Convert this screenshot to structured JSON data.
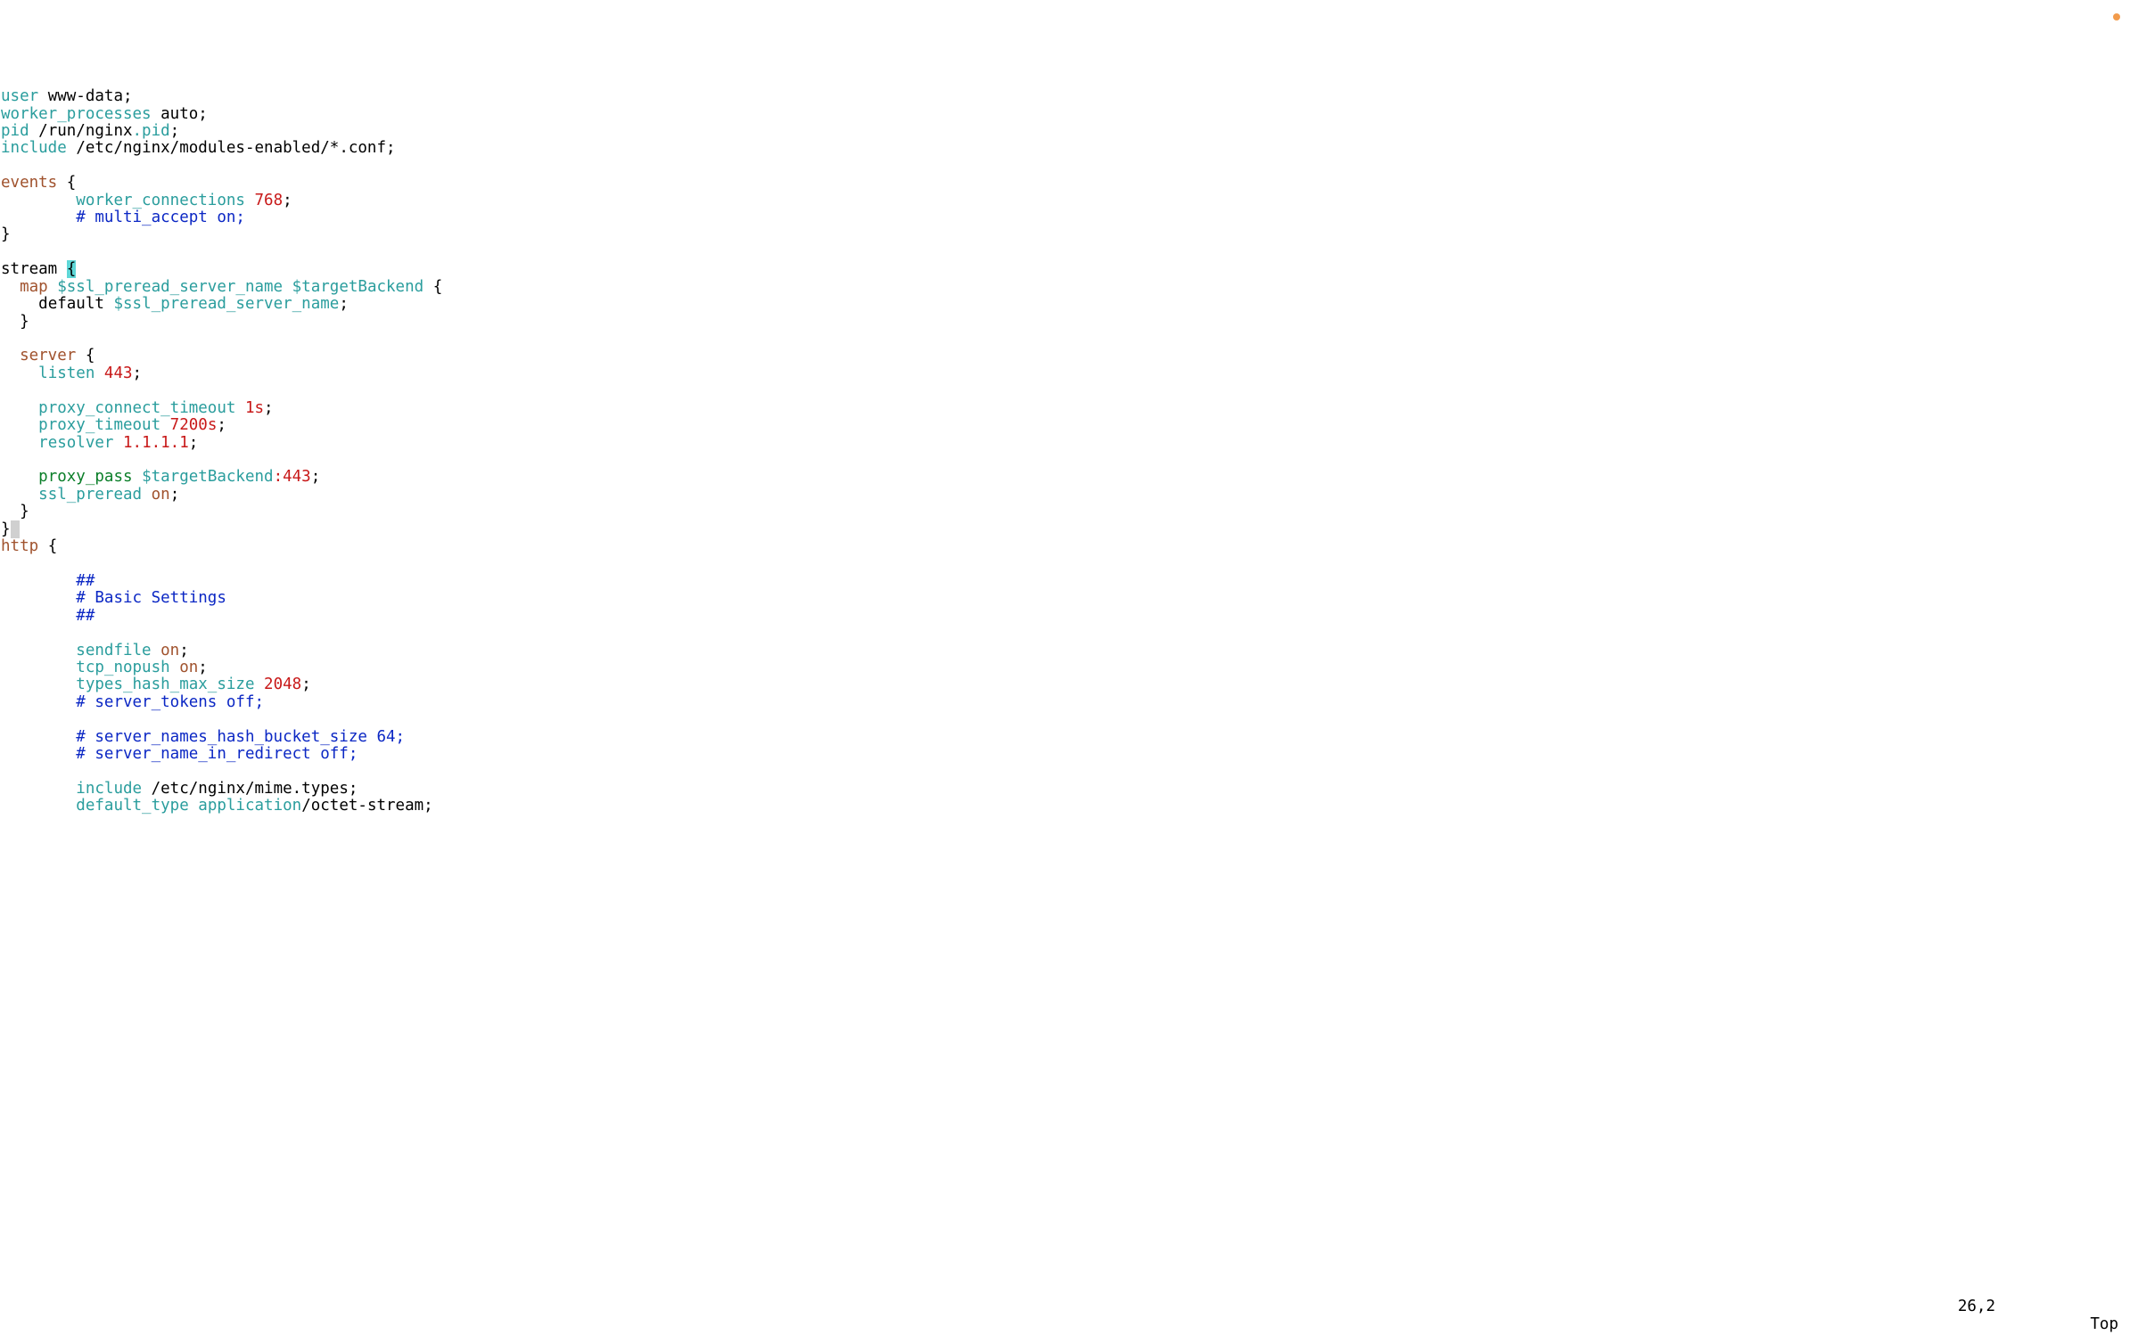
{
  "lines": {
    "l1_user": "user",
    "l1_val": "www-data",
    "l2_wp": "worker_processes",
    "l2_val": "auto",
    "l3_pid": "pid",
    "l3_run": "/run/nginx",
    "l3_dotpid": ".pid",
    "l4_inc": "include",
    "l4_path": "/etc/nginx/modules-enabled/*.conf",
    "l6_events": "events",
    "l7_wc": "worker_connections",
    "l7_val": "768",
    "l8_cmt": "# multi_accept on;",
    "l11_stream": "stream",
    "l12_map": "map",
    "l12_v1": "$ssl_preread_server_name",
    "l12_v2": "$targetBackend",
    "l13_def": "default",
    "l13_val": "$ssl_preread_server_name",
    "l16_server": "server",
    "l17_listen": "listen",
    "l17_val": "443",
    "l19_pct": "proxy_connect_timeout",
    "l19_val": "1s",
    "l20_pt": "proxy_timeout",
    "l20_val": "7200s",
    "l21_res": "resolver",
    "l21_val": "1.1.1.1",
    "l23_pp": "proxy_pass",
    "l23_tb": "$targetBackend",
    "l23_port": ":443",
    "l24_sp": "ssl_preread",
    "l24_val": "on",
    "l27_http": "http",
    "l29_c": "##",
    "l30_c": "# Basic Settings",
    "l31_c": "##",
    "l33_sf": "sendfile",
    "l33_val": "on",
    "l34_tn": "tcp_nopush",
    "l34_val": "on",
    "l35_th": "types_hash_max_size",
    "l35_val": "2048",
    "l36_c": "# server_tokens off;",
    "l38_c": "# server_names_hash_bucket_size 64;",
    "l39_c": "# server_name_in_redirect off;",
    "l41_inc": "include",
    "l41_path": "/etc/nginx/mime.types",
    "l42_dt": "default_type",
    "l42_app": "application",
    "l42_os": "/octet-stream"
  },
  "status": {
    "pos": "26,2",
    "pct": "Top"
  }
}
